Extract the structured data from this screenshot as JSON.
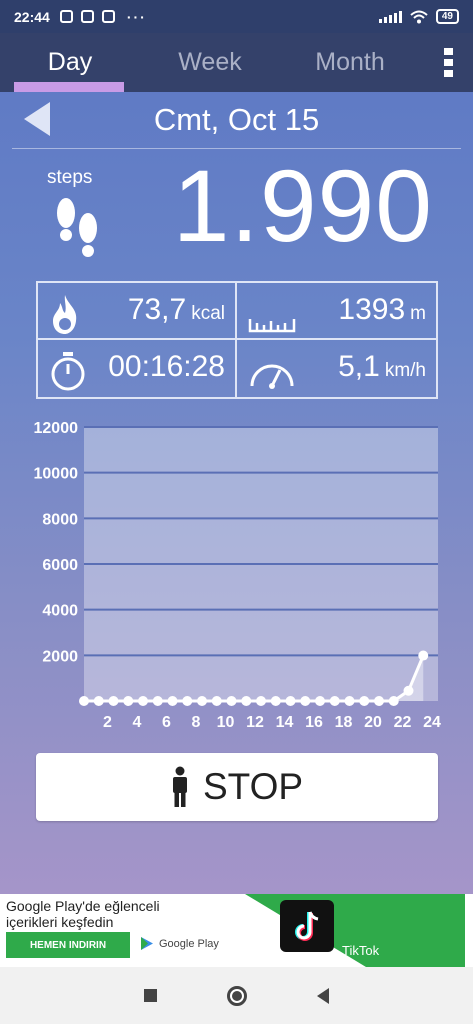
{
  "status_bar": {
    "time": "22:44",
    "battery": "49",
    "more": "···"
  },
  "tabs": [
    {
      "label": "Day"
    },
    {
      "label": "Week"
    },
    {
      "label": "Month"
    }
  ],
  "date": "Cmt, Oct 15",
  "steps": {
    "label": "steps",
    "value": "1.990"
  },
  "stats": {
    "calories": {
      "value": "73,7",
      "unit": "kcal"
    },
    "distance": {
      "value": "1393",
      "unit": "m"
    },
    "duration": {
      "value": "00:16:28",
      "unit": ""
    },
    "speed": {
      "value": "5,1",
      "unit": "km/h"
    }
  },
  "chart_data": {
    "type": "line",
    "title": "",
    "xlabel": "",
    "ylabel": "",
    "ylim": [
      0,
      12000
    ],
    "yticks": [
      2000,
      4000,
      6000,
      8000,
      10000,
      12000
    ],
    "xlim": [
      0,
      24
    ],
    "xticks": [
      2,
      4,
      6,
      8,
      10,
      12,
      14,
      16,
      18,
      20,
      22,
      24
    ],
    "grid": true,
    "series": [
      {
        "x": [
          0,
          1,
          2,
          3,
          4,
          5,
          6,
          7,
          8,
          9,
          10,
          11,
          12,
          13,
          14,
          15,
          16,
          17,
          18,
          19,
          20,
          21,
          22,
          23
        ],
        "values": [
          0,
          0,
          0,
          0,
          0,
          0,
          0,
          0,
          0,
          0,
          0,
          0,
          0,
          0,
          0,
          0,
          0,
          0,
          0,
          0,
          0,
          0,
          450,
          1990
        ]
      }
    ]
  },
  "stop_button": {
    "label": "STOP"
  },
  "ad": {
    "line1": "Google Play'de eğlenceli",
    "line2": "içerikleri keşfedin",
    "install": "HEMEN INDIRIN",
    "store": "Google Play",
    "app_name": "TikTok"
  },
  "colors": {
    "tab_bar": "#34416a",
    "tab_indicator": "#c89be6",
    "background_top": "#5d78c4",
    "background_bottom": "#a595c9"
  }
}
